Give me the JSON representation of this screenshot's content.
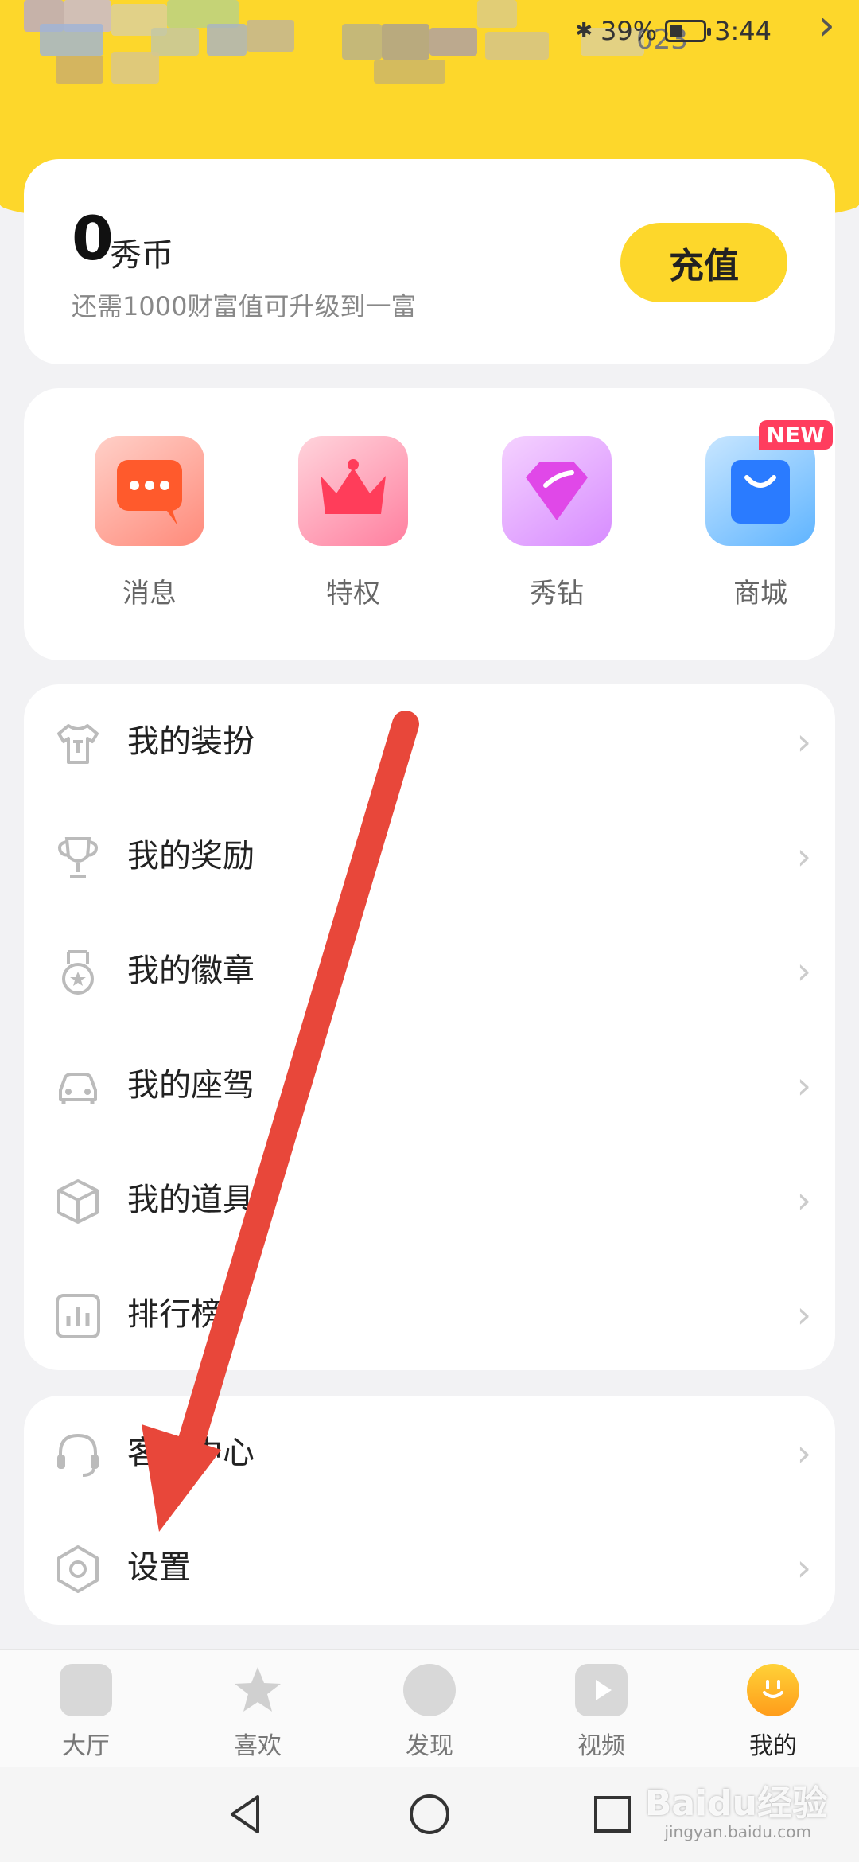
{
  "status_bar": {
    "battery": "39%",
    "time": "3:44",
    "obscured_suffix": "023"
  },
  "wallet": {
    "amount": "0",
    "unit": "秀币",
    "hint": "还需1000财富值可升级到一富",
    "recharge_label": "充值"
  },
  "quick_actions": [
    {
      "label": "消息",
      "icon": "message-bubble-icon"
    },
    {
      "label": "特权",
      "icon": "crown-icon"
    },
    {
      "label": "秀钻",
      "icon": "diamond-icon"
    },
    {
      "label": "商城",
      "icon": "shopping-bag-icon",
      "badge": "NEW"
    }
  ],
  "menu": [
    {
      "label": "我的装扮",
      "icon": "tshirt-icon"
    },
    {
      "label": "我的奖励",
      "icon": "trophy-icon"
    },
    {
      "label": "我的徽章",
      "icon": "medal-icon"
    },
    {
      "label": "我的座驾",
      "icon": "car-icon"
    },
    {
      "label": "我的道具",
      "icon": "box-icon"
    },
    {
      "label": "排行榜",
      "icon": "chart-icon"
    }
  ],
  "menu2": [
    {
      "label": "客服中心",
      "icon": "headset-icon"
    },
    {
      "label": "设置",
      "icon": "settings-hexagon-icon"
    }
  ],
  "tabs": [
    {
      "label": "大厅",
      "icon": "home-icon"
    },
    {
      "label": "喜欢",
      "icon": "star-icon"
    },
    {
      "label": "发现",
      "icon": "compass-icon"
    },
    {
      "label": "视频",
      "icon": "play-icon"
    },
    {
      "label": "我的",
      "icon": "profile-mascot-icon",
      "active": true
    }
  ],
  "watermark": {
    "brand": "Baidu经验",
    "url": "jingyan.baidu.com"
  },
  "colors": {
    "brand_yellow": "#fdd72b",
    "arrow_red": "#e8473a"
  }
}
